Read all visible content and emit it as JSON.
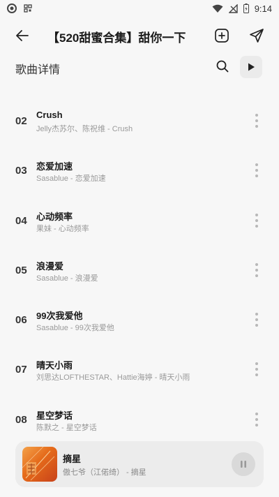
{
  "status_bar": {
    "time": "9:14"
  },
  "header": {
    "title": "【520甜蜜合集】甜你一下"
  },
  "section": {
    "title": "歌曲详情"
  },
  "songs": [
    {
      "num": "02",
      "title": "Crush",
      "sub": "Jelly杰苏尔、陈祝维 - Crush"
    },
    {
      "num": "03",
      "title": "恋爱加速",
      "sub": "Sasablue - 恋爱加速"
    },
    {
      "num": "04",
      "title": "心动频率",
      "sub": "果妹 - 心动频率"
    },
    {
      "num": "05",
      "title": "浪漫爱",
      "sub": "Sasablue - 浪漫爱"
    },
    {
      "num": "06",
      "title": "99次我爱他",
      "sub": "Sasablue - 99次我爱他"
    },
    {
      "num": "07",
      "title": "晴天小雨",
      "sub": "刘思达LOFTHESTAR、Hattie海婷 - 晴天小雨"
    },
    {
      "num": "08",
      "title": "星空梦话",
      "sub": "陈默之 - 星空梦话"
    }
  ],
  "now_playing": {
    "title": "摘星",
    "sub": "傲七爷（江偌绮） - 摘星"
  },
  "colors": {
    "background": "#f7f7f7",
    "player_bg": "#ececec",
    "cover_accent": "#e56a1a"
  }
}
